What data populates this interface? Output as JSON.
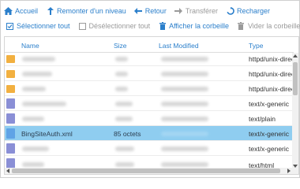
{
  "toolbar": {
    "home_label": "Accueil",
    "up_label": "Remonter d'un niveau",
    "back_label": "Retour",
    "forward_label": "Transférer",
    "reload_label": "Recharger",
    "select_all_label": "Sélectionner tout",
    "deselect_all_label": "Désélectionner tout",
    "show_trash_label": "Afficher la corbeille",
    "empty_trash_label": "Vider la corbeille"
  },
  "table": {
    "columns": {
      "name": "Name",
      "size": "Size",
      "modified": "Last Modified",
      "type": "Type"
    },
    "rows": [
      {
        "icon": "folder-icon",
        "type": "httpd/unix-directory"
      },
      {
        "icon": "folder-icon",
        "type": "httpd/unix-directory"
      },
      {
        "icon": "folder-icon",
        "type": "httpd/unix-directory"
      },
      {
        "icon": "file-icon",
        "type": "text/x-generic"
      },
      {
        "icon": "file-icon",
        "type": "text/plain"
      },
      {
        "icon": "document-icon",
        "name": "BingSiteAuth.xml",
        "size": "85 octets",
        "type": "text/x-generic",
        "selected": true
      },
      {
        "icon": "file-icon",
        "type": "text/x-generic"
      },
      {
        "icon": "file-icon",
        "type": "text/html"
      }
    ]
  },
  "colors": {
    "accent": "#2b7fcb",
    "selected_row": "#8fcdf0",
    "folder": "#f2b040"
  }
}
